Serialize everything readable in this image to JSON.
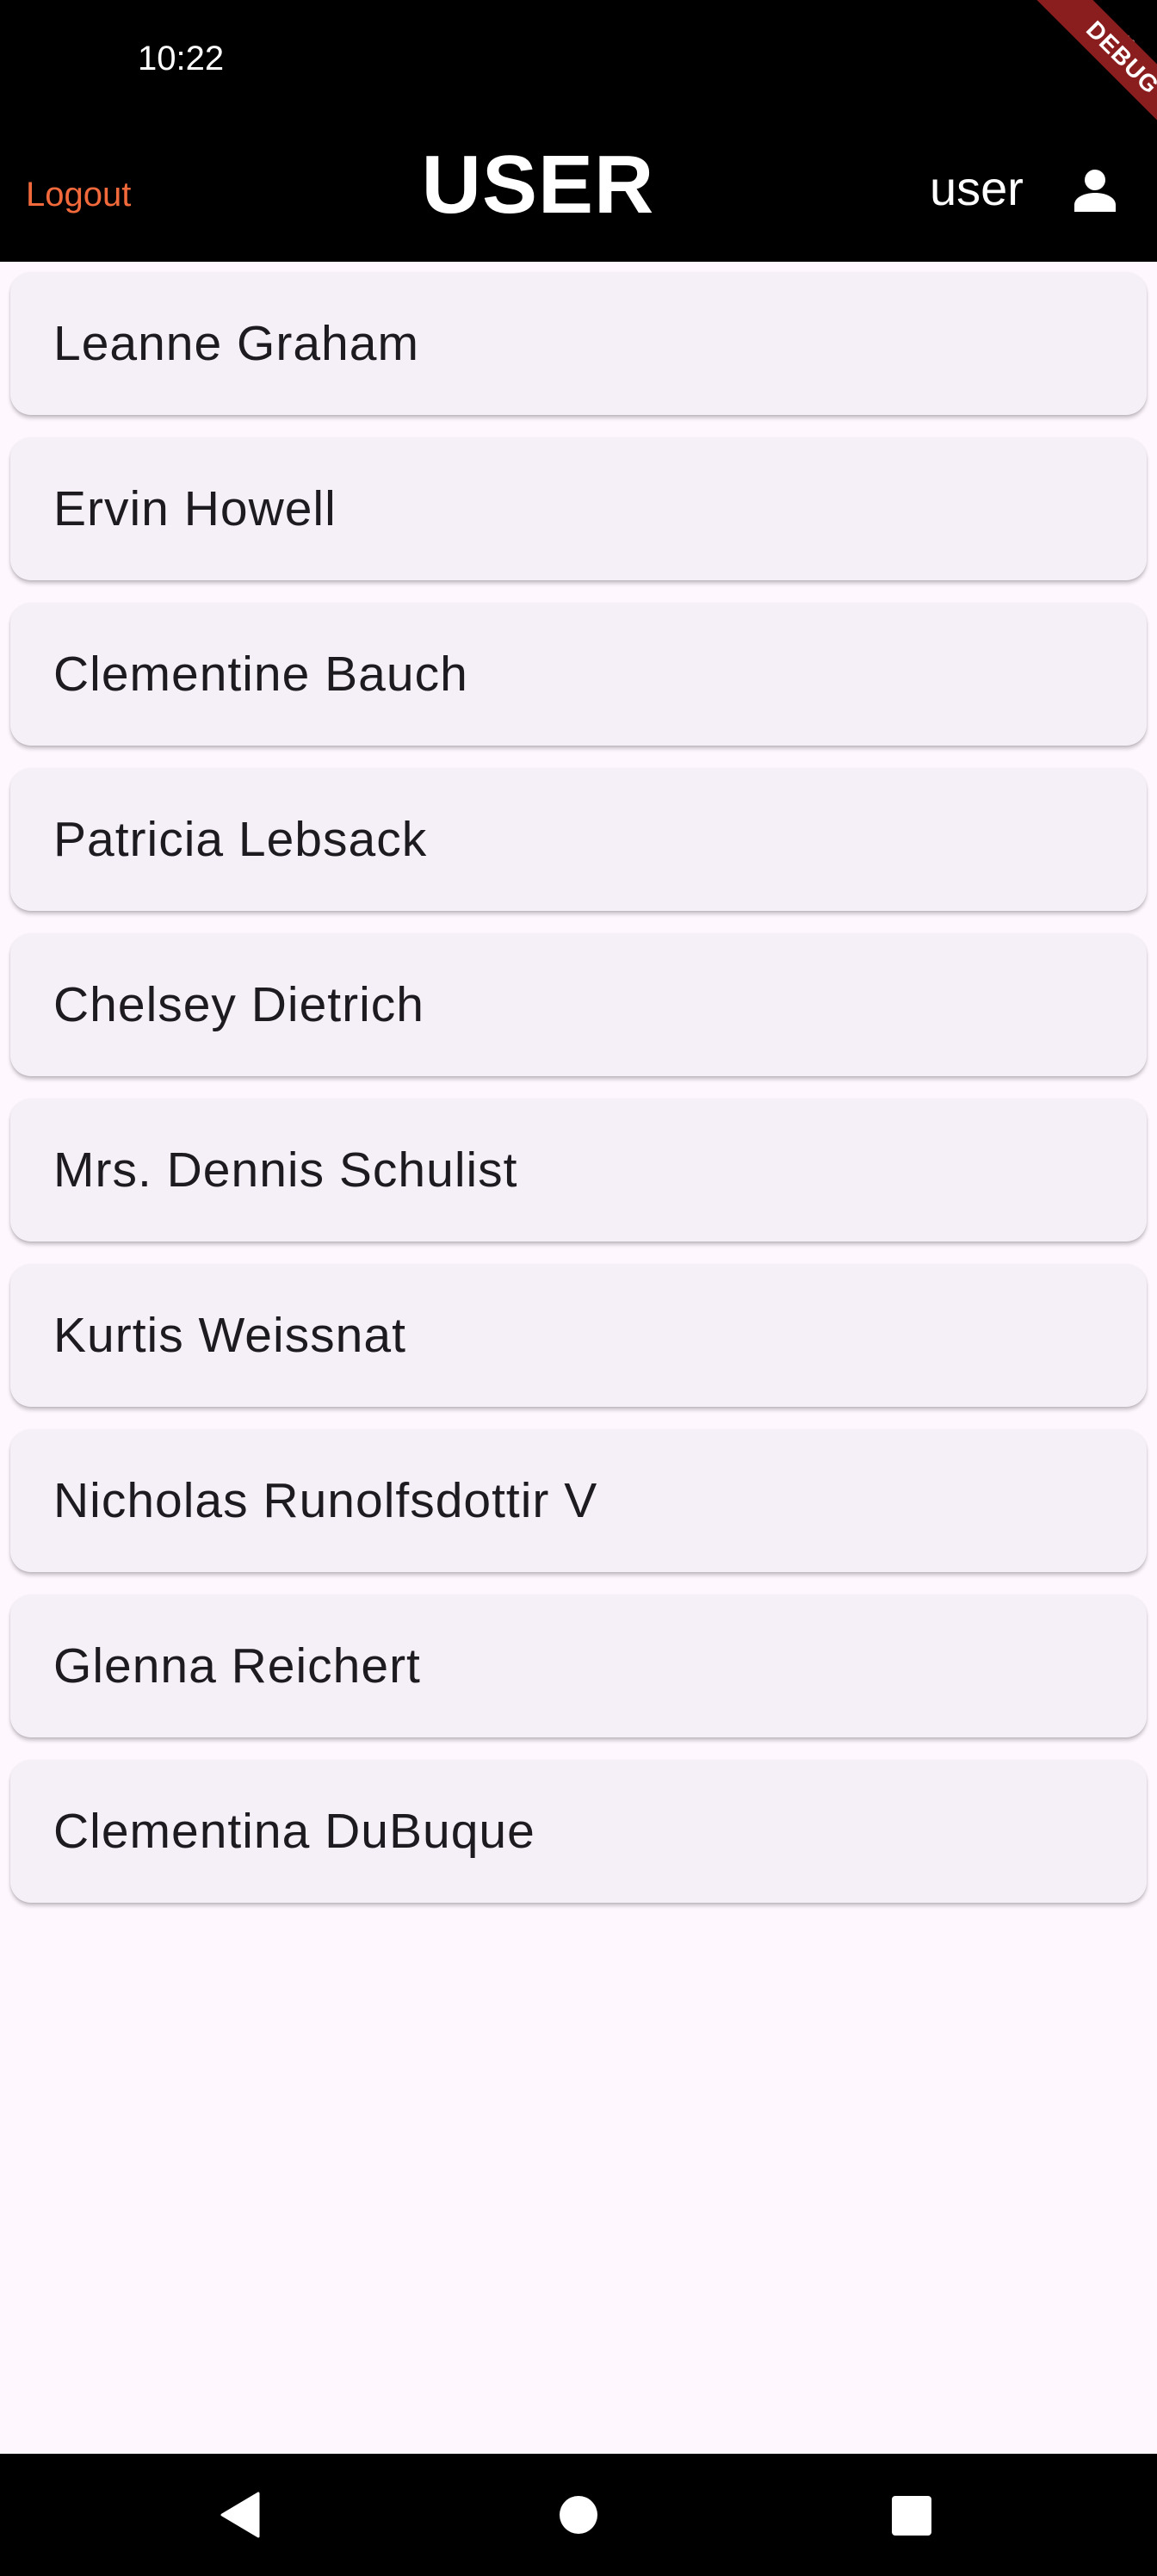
{
  "status_bar": {
    "time": "10:22",
    "battery_icon": "battery-icon"
  },
  "debug_banner": {
    "label": "DEBUG",
    "color": "#8a1d1d"
  },
  "app_bar": {
    "logout_label": "Logout",
    "title": "USER",
    "user_label": "user",
    "user_icon": "person-icon",
    "logout_color": "#f26a3b",
    "background": "#000000"
  },
  "users": [
    {
      "name": "Leanne Graham"
    },
    {
      "name": "Ervin Howell"
    },
    {
      "name": "Clementine Bauch"
    },
    {
      "name": "Patricia Lebsack"
    },
    {
      "name": "Chelsey Dietrich"
    },
    {
      "name": "Mrs. Dennis Schulist"
    },
    {
      "name": "Kurtis Weissnat"
    },
    {
      "name": "Nicholas Runolfsdottir V"
    },
    {
      "name": "Glenna Reichert"
    },
    {
      "name": "Clementina DuBuque"
    }
  ],
  "nav_bar": {
    "back_icon": "back-triangle-icon",
    "home_icon": "home-circle-icon",
    "recents_icon": "recents-square-icon"
  },
  "colors": {
    "page_background": "#fef7fe",
    "card_background": "#f5eff7",
    "card_text": "#1d1b20"
  }
}
